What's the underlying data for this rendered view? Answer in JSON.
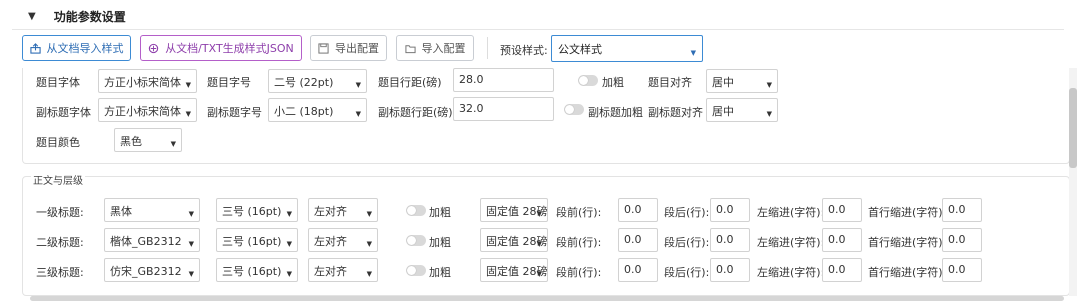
{
  "section": {
    "toggle": "▼",
    "title": "功能参数设置"
  },
  "toolbar": {
    "import_doc": "从文档导入样式",
    "gen_json": "从文档/TXT生成样式JSON",
    "export_cfg": "导出配置",
    "import_cfg": "导入配置",
    "preset_label": "预设样式:",
    "preset_value": "公文样式"
  },
  "title_settings": {
    "row1": {
      "font_label": "题目字体",
      "font": "方正小标宋简体",
      "size_label": "题目字号",
      "size": "二号 (22pt)",
      "spacing_label": "题目行距(磅)",
      "spacing": "28.0",
      "bold_label": "加粗",
      "align_label": "题目对齐",
      "align": "居中"
    },
    "row2": {
      "font_label": "副标题字体",
      "font": "方正小标宋简体",
      "size_label": "副标题字号",
      "size": "小二 (18pt)",
      "spacing_label": "副标题行距(磅)",
      "spacing": "32.0",
      "bold_label": "副标题加粗",
      "align_label": "副标题对齐",
      "align": "居中"
    },
    "row3": {
      "color_label": "题目颜色",
      "color": "黑色"
    }
  },
  "body_section": {
    "title": "正文与层级",
    "col_labels": {
      "before": "段前(行):",
      "after": "段后(行):",
      "left_indent": "左缩进(字符):",
      "first_indent": "首行缩进(字符):",
      "bold": "加粗"
    },
    "rows": [
      {
        "label": "一级标题:",
        "font": "黑体",
        "size": "三号 (16pt)",
        "align": "左对齐",
        "spacing": "固定值 28磅",
        "before": "0.0",
        "after": "0.0",
        "left": "0.0",
        "first": "0.0"
      },
      {
        "label": "二级标题:",
        "font": "楷体_GB2312",
        "size": "三号 (16pt)",
        "align": "左对齐",
        "spacing": "固定值 28磅",
        "before": "0.0",
        "after": "0.0",
        "left": "0.0",
        "first": "0.0"
      },
      {
        "label": "三级标题:",
        "font": "仿宋_GB2312",
        "size": "三号 (16pt)",
        "align": "左对齐",
        "spacing": "固定值 28磅",
        "before": "0.0",
        "after": "0.0",
        "left": "0.0",
        "first": "0.0"
      }
    ]
  },
  "colors": {
    "accent": "#3d8bd4",
    "purple": "#b45fc9"
  }
}
